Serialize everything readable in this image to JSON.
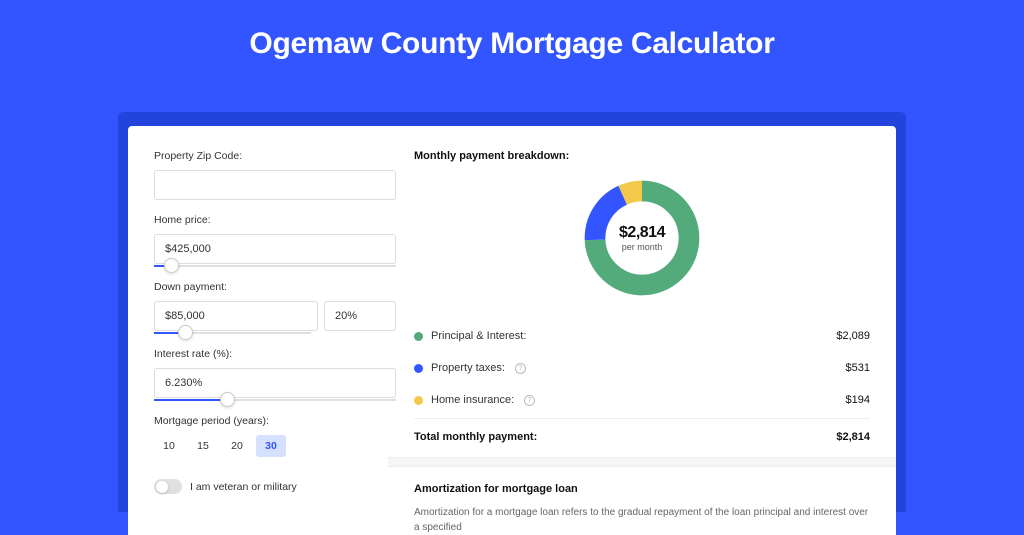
{
  "page": {
    "title": "Ogemaw County Mortgage Calculator"
  },
  "form": {
    "zip_label": "Property Zip Code:",
    "zip_value": "",
    "home_price_label": "Home price:",
    "home_price_value": "$425,000",
    "home_price_slider_pct": 7,
    "down_payment_label": "Down payment:",
    "down_payment_value": "$85,000",
    "down_payment_pct": "20%",
    "down_payment_slider_pct": 20,
    "interest_label": "Interest rate (%):",
    "interest_value": "6.230%",
    "interest_slider_pct": 30,
    "period_label": "Mortgage period (years):",
    "periods": [
      "10",
      "15",
      "20",
      "30"
    ],
    "period_selected": "30",
    "veteran_label": "I am veteran or military"
  },
  "breakdown": {
    "title": "Monthly payment breakdown:",
    "donut_amount": "$2,814",
    "donut_per": "per month",
    "items": [
      {
        "label": "Principal & Interest:",
        "value": "$2,089",
        "color": "#53aa7a",
        "info": false
      },
      {
        "label": "Property taxes:",
        "value": "$531",
        "color": "#3355ff",
        "info": true
      },
      {
        "label": "Home insurance:",
        "value": "$194",
        "color": "#f3c94c",
        "info": true
      }
    ],
    "total_label": "Total monthly payment:",
    "total_value": "$2,814"
  },
  "amortization": {
    "title": "Amortization for mortgage loan",
    "text": "Amortization for a mortgage loan refers to the gradual repayment of the loan principal and interest over a specified"
  },
  "chart_data": {
    "type": "pie",
    "title": "Monthly payment breakdown",
    "total": 2814,
    "series": [
      {
        "name": "Principal & Interest",
        "value": 2089,
        "color": "#53aa7a"
      },
      {
        "name": "Property taxes",
        "value": 531,
        "color": "#3355ff"
      },
      {
        "name": "Home insurance",
        "value": 194,
        "color": "#f3c94c"
      }
    ]
  }
}
